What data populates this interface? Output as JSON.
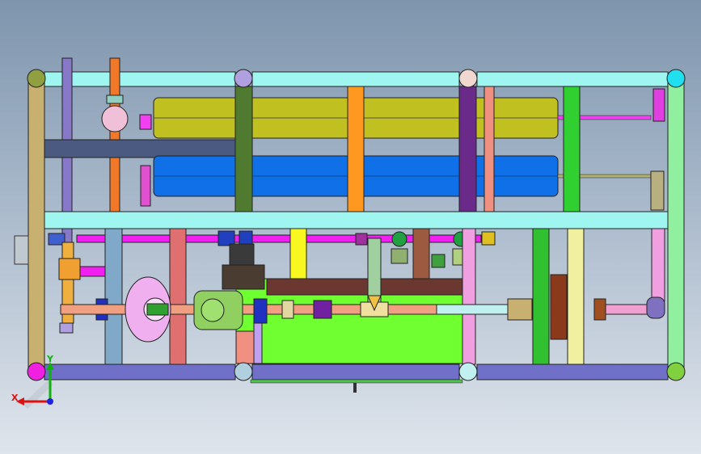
{
  "view": {
    "background_top": "#7e95ad",
    "background_bottom": "#dfe5ec"
  },
  "triad": {
    "x_label": "X",
    "y_label": "Y",
    "x_color": "#e01010",
    "y_color": "#10b010",
    "z_color": "#2020e0"
  },
  "colors": {
    "frame_cyan": "#9ff5f0",
    "frame_purple": "#7070c8",
    "tank_olive": "#c0c020",
    "tank_blue": "#1070e8",
    "box_green": "#70ff30",
    "pipe_salmon": "#f0a080",
    "pipe_magenta": "#f020f0",
    "pump_green": "#90d060",
    "motor_dark": "#4a3c30",
    "column_orange": "#ff9820",
    "column_brown": "#9c5a40",
    "column_yellow": "#f8f820"
  }
}
